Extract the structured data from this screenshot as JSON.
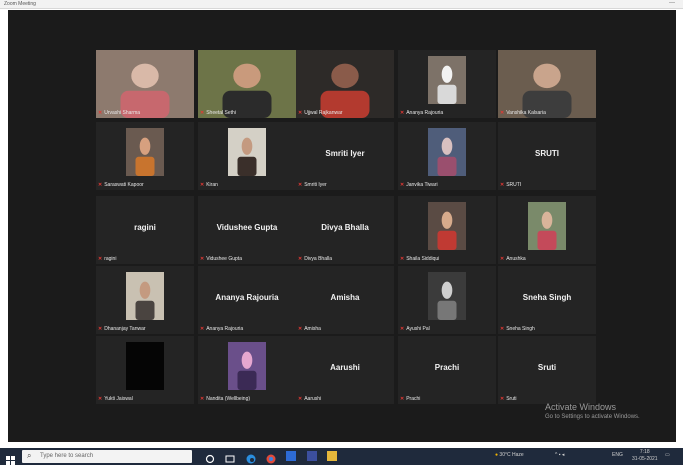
{
  "window": {
    "title": "Zoom Meeting",
    "right_mark": "—"
  },
  "participants": [
    {
      "name": "Urvashi Sharma",
      "center": "",
      "video": "woman-pink",
      "row": 0,
      "col": 0,
      "active": false
    },
    {
      "name": "Sheetal Sethi",
      "center": "",
      "video": "woman-smiling",
      "row": 0,
      "col": 1,
      "active": false
    },
    {
      "name": "Ujjwal Rajkanwar",
      "center": "",
      "video": "man-red-cap",
      "row": 0,
      "col": 2,
      "active": true
    },
    {
      "name": "Ananya Rajouria",
      "center": "",
      "video": "white-board",
      "row": 0,
      "col": 3,
      "active": false
    },
    {
      "name": "Vanshika Kalsaria",
      "center": "",
      "video": "man-bookshelf",
      "row": 0,
      "col": 4,
      "active": false
    },
    {
      "name": "Saraswati Kapoor",
      "center": "",
      "video": "woman-orange",
      "row": 1,
      "col": 0,
      "active": false
    },
    {
      "name": "Kiran",
      "center": "",
      "video": "young-man",
      "row": 1,
      "col": 1,
      "active": false
    },
    {
      "name": "Smriti Iyer",
      "center": "Smriti Iyer",
      "video": "",
      "row": 1,
      "col": 2,
      "active": false
    },
    {
      "name": "Janvika Tiwari",
      "center": "",
      "video": "group-photo",
      "row": 1,
      "col": 3,
      "active": false
    },
    {
      "name": "SRUTI",
      "center": "SRUTI",
      "video": "",
      "row": 1,
      "col": 4,
      "active": false
    },
    {
      "name": "ragini",
      "center": "ragini",
      "video": "",
      "row": 2,
      "col": 0,
      "active": false
    },
    {
      "name": "Vidushee Gupta",
      "center": "Vidushee Gupta",
      "video": "",
      "row": 2,
      "col": 1,
      "active": false
    },
    {
      "name": "Divya Bhalla",
      "center": "Divya Bhalla",
      "video": "",
      "row": 2,
      "col": 2,
      "active": false
    },
    {
      "name": "Shaila Siddiqui",
      "center": "",
      "video": "woman-red",
      "row": 2,
      "col": 3,
      "active": false
    },
    {
      "name": "Anushka",
      "center": "",
      "video": "woman-outdoor",
      "row": 2,
      "col": 4,
      "active": false
    },
    {
      "name": "Dhananjay Tanwar",
      "center": "",
      "video": "man-glasses",
      "row": 3,
      "col": 0,
      "active": false
    },
    {
      "name": "Ananya Rajouria",
      "center": "Ananya Rajouria",
      "video": "",
      "row": 3,
      "col": 1,
      "active": false
    },
    {
      "name": "Amisha",
      "center": "Amisha",
      "video": "",
      "row": 3,
      "col": 2,
      "active": false
    },
    {
      "name": "Ayushi Pal",
      "center": "",
      "video": "man-mono",
      "row": 3,
      "col": 3,
      "active": false
    },
    {
      "name": "Sneha Singh",
      "center": "Sneha Singh",
      "video": "",
      "row": 3,
      "col": 4,
      "active": false
    },
    {
      "name": "Yukti Jaiswal",
      "center": "",
      "video": "black-square",
      "row": 4,
      "col": 0,
      "active": false
    },
    {
      "name": "Nandita (Wellbeing)",
      "center": "",
      "video": "pink-tree",
      "row": 4,
      "col": 1,
      "active": false
    },
    {
      "name": "Aarushi",
      "center": "Aarushi",
      "video": "",
      "row": 4,
      "col": 2,
      "active": false
    },
    {
      "name": "Prachi",
      "center": "Prachi",
      "video": "",
      "row": 4,
      "col": 3,
      "active": false
    },
    {
      "name": "Sruti",
      "center": "Sruti",
      "video": "",
      "row": 4,
      "col": 4,
      "active": false
    }
  ],
  "watermark": {
    "line1": "Activate Windows",
    "line2": "Go to Settings to activate Windows."
  },
  "taskbar": {
    "search_placeholder": "Type here to search",
    "weather": "30°C Haze",
    "lang": "ENG",
    "time": "7:18",
    "date": "31-05-2021"
  }
}
